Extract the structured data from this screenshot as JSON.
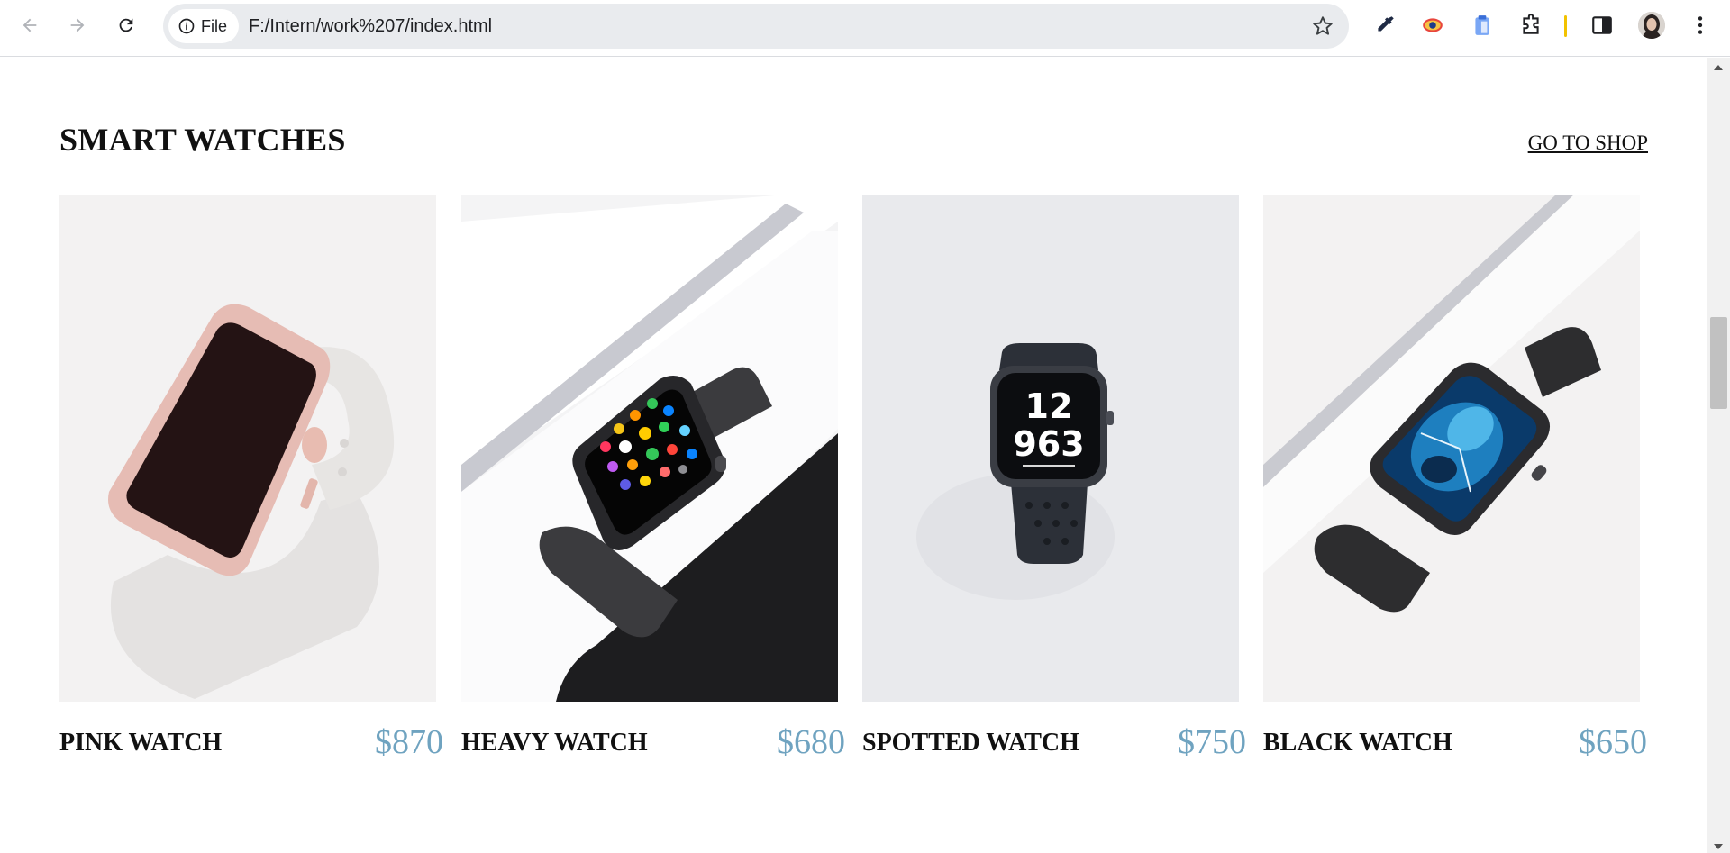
{
  "browser": {
    "site_chip_label": "File",
    "url": "F:/Intern/work%207/index.html",
    "icons": [
      "back-icon",
      "forward-icon",
      "reload-icon",
      "info-icon",
      "bookmark-star-icon",
      "eyedropper-icon",
      "eye-extension-icon",
      "clipboard-extension-icon",
      "puzzle-extensions-icon",
      "side-panel-icon",
      "profile-avatar",
      "more-menu-icon"
    ]
  },
  "section": {
    "title": "SMART WATCHES",
    "shop_link": "GO TO SHOP"
  },
  "products": [
    {
      "name": "PINK WATCH",
      "price": "$870"
    },
    {
      "name": "HEAVY WATCH",
      "price": "$680"
    },
    {
      "name": "SPOTTED WATCH",
      "price": "$750"
    },
    {
      "name": "BLACK WATCH",
      "price": "$650"
    }
  ],
  "colors": {
    "price": "#6fa3c0",
    "title": "#111111",
    "omnibox": "#e9ebee"
  }
}
